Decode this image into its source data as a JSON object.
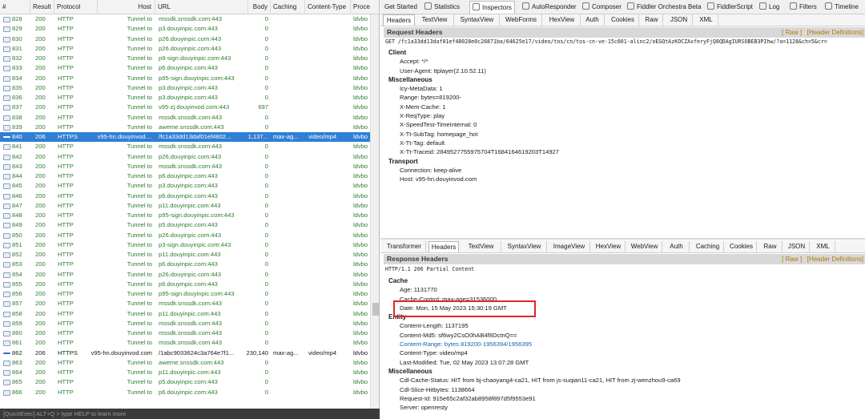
{
  "sessions": {
    "columns": {
      "num": "#",
      "result": "Result",
      "protocol": "Protocol",
      "host": "Host",
      "url": "URL",
      "body": "Body",
      "caching": "Caching",
      "ctype": "Content-Type",
      "process": "Proce"
    },
    "rows": [
      {
        "num": "828",
        "result": "200",
        "protocol": "HTTP",
        "host": "Tunnel to",
        "url": "mssdk.snssdk.com:443",
        "body": "0",
        "caching": "",
        "ctype": "",
        "process": "ldvbo",
        "kind": "normal"
      },
      {
        "num": "829",
        "result": "200",
        "protocol": "HTTP",
        "host": "Tunnel to",
        "url": "p3.douyinpic.com:443",
        "body": "0",
        "caching": "",
        "ctype": "",
        "process": "ldvbo",
        "kind": "normal"
      },
      {
        "num": "830",
        "result": "200",
        "protocol": "HTTP",
        "host": "Tunnel to",
        "url": "p26.douyinpic.com:443",
        "body": "0",
        "caching": "",
        "ctype": "",
        "process": "ldvbo",
        "kind": "normal"
      },
      {
        "num": "831",
        "result": "200",
        "protocol": "HTTP",
        "host": "Tunnel to",
        "url": "p26.douyinpic.com:443",
        "body": "0",
        "caching": "",
        "ctype": "",
        "process": "ldvbo",
        "kind": "normal"
      },
      {
        "num": "832",
        "result": "200",
        "protocol": "HTTP",
        "host": "Tunnel to",
        "url": "p9-sign.douyinpic.com:443",
        "body": "0",
        "caching": "",
        "ctype": "",
        "process": "ldvbo",
        "kind": "normal"
      },
      {
        "num": "833",
        "result": "200",
        "protocol": "HTTP",
        "host": "Tunnel to",
        "url": "p6.douyinpic.com:443",
        "body": "0",
        "caching": "",
        "ctype": "",
        "process": "ldvbo",
        "kind": "normal"
      },
      {
        "num": "834",
        "result": "200",
        "protocol": "HTTP",
        "host": "Tunnel to",
        "url": "p95-sign.douyinpic.com:443",
        "body": "0",
        "caching": "",
        "ctype": "",
        "process": "ldvbo",
        "kind": "normal"
      },
      {
        "num": "835",
        "result": "200",
        "protocol": "HTTP",
        "host": "Tunnel to",
        "url": "p3.douyinpic.com:443",
        "body": "0",
        "caching": "",
        "ctype": "",
        "process": "ldvbo",
        "kind": "normal"
      },
      {
        "num": "836",
        "result": "200",
        "protocol": "HTTP",
        "host": "Tunnel to",
        "url": "p3.douyinpic.com:443",
        "body": "0",
        "caching": "",
        "ctype": "",
        "process": "ldvbo",
        "kind": "normal"
      },
      {
        "num": "837",
        "result": "200",
        "protocol": "HTTP",
        "host": "Tunnel to",
        "url": "v95-zj.douyinvod.com:443",
        "body": "697",
        "caching": "",
        "ctype": "",
        "process": "ldvbo",
        "kind": "normal"
      },
      {
        "num": "838",
        "result": "200",
        "protocol": "HTTP",
        "host": "Tunnel to",
        "url": "mssdk.snssdk.com:443",
        "body": "0",
        "caching": "",
        "ctype": "",
        "process": "ldvbo",
        "kind": "normal"
      },
      {
        "num": "839",
        "result": "200",
        "protocol": "HTTP",
        "host": "Tunnel to",
        "url": "aweme.snssdk.com:443",
        "body": "0",
        "caching": "",
        "ctype": "",
        "process": "ldvbo",
        "kind": "normal"
      },
      {
        "num": "840",
        "result": "206",
        "protocol": "HTTPS",
        "host": "v95-hn.douyinvod....",
        "url": "/fc1a33dd13daf01ef4802...",
        "body": "1,137...",
        "caching": "max-ag...",
        "ctype": "video/mp4",
        "process": "ldvbo",
        "kind": "selected"
      },
      {
        "num": "841",
        "result": "200",
        "protocol": "HTTP",
        "host": "Tunnel to",
        "url": "mssdk.snssdk.com:443",
        "body": "0",
        "caching": "",
        "ctype": "",
        "process": "ldvbo",
        "kind": "normal"
      },
      {
        "num": "842",
        "result": "200",
        "protocol": "HTTP",
        "host": "Tunnel to",
        "url": "p26.douyinpic.com:443",
        "body": "0",
        "caching": "",
        "ctype": "",
        "process": "ldvbo",
        "kind": "normal"
      },
      {
        "num": "843",
        "result": "200",
        "protocol": "HTTP",
        "host": "Tunnel to",
        "url": "mssdk.snssdk.com:443",
        "body": "0",
        "caching": "",
        "ctype": "",
        "process": "ldvbo",
        "kind": "normal"
      },
      {
        "num": "844",
        "result": "200",
        "protocol": "HTTP",
        "host": "Tunnel to",
        "url": "p6.douyinpic.com:443",
        "body": "0",
        "caching": "",
        "ctype": "",
        "process": "ldvbo",
        "kind": "normal"
      },
      {
        "num": "845",
        "result": "200",
        "protocol": "HTTP",
        "host": "Tunnel to",
        "url": "p3.douyinpic.com:443",
        "body": "0",
        "caching": "",
        "ctype": "",
        "process": "ldvbo",
        "kind": "normal"
      },
      {
        "num": "846",
        "result": "200",
        "protocol": "HTTP",
        "host": "Tunnel to",
        "url": "p6.douyinpic.com:443",
        "body": "0",
        "caching": "",
        "ctype": "",
        "process": "ldvbo",
        "kind": "normal"
      },
      {
        "num": "847",
        "result": "200",
        "protocol": "HTTP",
        "host": "Tunnel to",
        "url": "p11.douyinpic.com:443",
        "body": "0",
        "caching": "",
        "ctype": "",
        "process": "ldvbo",
        "kind": "normal"
      },
      {
        "num": "848",
        "result": "200",
        "protocol": "HTTP",
        "host": "Tunnel to",
        "url": "p95-sign.douyinpic.com:443",
        "body": "0",
        "caching": "",
        "ctype": "",
        "process": "ldvbo",
        "kind": "normal"
      },
      {
        "num": "849",
        "result": "200",
        "protocol": "HTTP",
        "host": "Tunnel to",
        "url": "p5.douyinpic.com:443",
        "body": "0",
        "caching": "",
        "ctype": "",
        "process": "ldvbo",
        "kind": "normal"
      },
      {
        "num": "850",
        "result": "200",
        "protocol": "HTTP",
        "host": "Tunnel to",
        "url": "p26.douyinpic.com:443",
        "body": "0",
        "caching": "",
        "ctype": "",
        "process": "ldvbo",
        "kind": "normal"
      },
      {
        "num": "851",
        "result": "200",
        "protocol": "HTTP",
        "host": "Tunnel to",
        "url": "p3-sign.douyinpic.com:443",
        "body": "0",
        "caching": "",
        "ctype": "",
        "process": "ldvbo",
        "kind": "normal"
      },
      {
        "num": "852",
        "result": "200",
        "protocol": "HTTP",
        "host": "Tunnel to",
        "url": "p11.douyinpic.com:443",
        "body": "0",
        "caching": "",
        "ctype": "",
        "process": "ldvbo",
        "kind": "normal"
      },
      {
        "num": "853",
        "result": "200",
        "protocol": "HTTP",
        "host": "Tunnel to",
        "url": "p6.douyinpic.com:443",
        "body": "0",
        "caching": "",
        "ctype": "",
        "process": "ldvbo",
        "kind": "normal"
      },
      {
        "num": "854",
        "result": "200",
        "protocol": "HTTP",
        "host": "Tunnel to",
        "url": "p26.douyinpic.com:443",
        "body": "0",
        "caching": "",
        "ctype": "",
        "process": "ldvbo",
        "kind": "normal"
      },
      {
        "num": "855",
        "result": "200",
        "protocol": "HTTP",
        "host": "Tunnel to",
        "url": "p6.douyinpic.com:443",
        "body": "0",
        "caching": "",
        "ctype": "",
        "process": "ldvbo",
        "kind": "normal"
      },
      {
        "num": "856",
        "result": "200",
        "protocol": "HTTP",
        "host": "Tunnel to",
        "url": "p95-sign.douyinpic.com:443",
        "body": "0",
        "caching": "",
        "ctype": "",
        "process": "ldvbo",
        "kind": "normal"
      },
      {
        "num": "857",
        "result": "200",
        "protocol": "HTTP",
        "host": "Tunnel to",
        "url": "mssdk.snssdk.com:443",
        "body": "0",
        "caching": "",
        "ctype": "",
        "process": "ldvbo",
        "kind": "normal"
      },
      {
        "num": "858",
        "result": "200",
        "protocol": "HTTP",
        "host": "Tunnel to",
        "url": "p11.douyinpic.com:443",
        "body": "0",
        "caching": "",
        "ctype": "",
        "process": "ldvbo",
        "kind": "normal"
      },
      {
        "num": "859",
        "result": "200",
        "protocol": "HTTP",
        "host": "Tunnel to",
        "url": "mssdk.snssdk.com:443",
        "body": "0",
        "caching": "",
        "ctype": "",
        "process": "ldvbo",
        "kind": "normal"
      },
      {
        "num": "860",
        "result": "200",
        "protocol": "HTTP",
        "host": "Tunnel to",
        "url": "mssdk.snssdk.com:443",
        "body": "0",
        "caching": "",
        "ctype": "",
        "process": "ldvbo",
        "kind": "normal"
      },
      {
        "num": "861",
        "result": "200",
        "protocol": "HTTP",
        "host": "Tunnel to",
        "url": "mssdk.snssdk.com:443",
        "body": "0",
        "caching": "",
        "ctype": "",
        "process": "ldvbo",
        "kind": "normal"
      },
      {
        "num": "862",
        "result": "206",
        "protocol": "HTTPS",
        "host": "v95-hn.douyinvod.com",
        "url": "/1abc9033624c3a764e7f1...",
        "body": "230,140",
        "caching": "max-ag...",
        "ctype": "video/mp4",
        "process": "ldvbo",
        "kind": "highlight"
      },
      {
        "num": "863",
        "result": "200",
        "protocol": "HTTP",
        "host": "Tunnel to",
        "url": "aweme.snssdk.com:443",
        "body": "0",
        "caching": "",
        "ctype": "",
        "process": "ldvbo",
        "kind": "normal"
      },
      {
        "num": "864",
        "result": "200",
        "protocol": "HTTP",
        "host": "Tunnel to",
        "url": "p11.douyinpic.com:443",
        "body": "0",
        "caching": "",
        "ctype": "",
        "process": "ldvbo",
        "kind": "normal"
      },
      {
        "num": "865",
        "result": "200",
        "protocol": "HTTP",
        "host": "Tunnel to",
        "url": "p5.douyinpic.com:443",
        "body": "0",
        "caching": "",
        "ctype": "",
        "process": "ldvbo",
        "kind": "normal"
      },
      {
        "num": "866",
        "result": "200",
        "protocol": "HTTP",
        "host": "Tunnel to",
        "url": "p6.douyinpic.com:443",
        "body": "0",
        "caching": "",
        "ctype": "",
        "process": "ldvbo",
        "kind": "normal"
      }
    ]
  },
  "quickexec": {
    "text": "[QuickExec] ALT+Q > type HELP to learn more"
  },
  "top_tabs": [
    {
      "label": "Get Started",
      "icon": ""
    },
    {
      "label": "Statistics",
      "icon": "clock-icon"
    },
    {
      "label": "Inspectors",
      "icon": "magnifier-icon"
    },
    {
      "label": "AutoResponder",
      "icon": "bolt-icon"
    },
    {
      "label": "Composer",
      "icon": "pencil-icon"
    },
    {
      "label": "Fiddler Orchestra Beta",
      "icon": "fo-icon"
    },
    {
      "label": "FiddlerScript",
      "icon": "script-icon"
    },
    {
      "label": "Log",
      "icon": "log-icon"
    },
    {
      "label": "Filters",
      "icon": "checkbox-icon"
    },
    {
      "label": "Timeline",
      "icon": "timeline-icon"
    }
  ],
  "request_tabs": [
    "Headers",
    "TextView",
    "SyntaxView",
    "WebForms",
    "HexView",
    "Auth",
    "Cookies",
    "Raw",
    "JSON",
    "XML"
  ],
  "request": {
    "section_title": "Request Headers",
    "raw_link": "[ Raw ]",
    "defs_link": "[Header Definitions]",
    "request_line": "GET /fc1a33dd13daf01ef48028e0c26871ba/64625e17/video/tos/cn/tos-cn-ve-15c001-alinc2/oEGQtAzKOCZAxferyFjQ8QDAgIURSOBEB3PIhw/?a=1128&ch=5&cr=",
    "groups": [
      {
        "name": "Client",
        "items": [
          "Accept: */*",
          "User-Agent: ttplayer(2.10.52.11)"
        ]
      },
      {
        "name": "Miscellaneous",
        "items": [
          "Icy-MetaData: 1",
          "Range: bytes=819200-",
          "X-Mem-Cache: 1",
          "X-ReqType: play",
          "X-SpeedTest-TimeInternal: 0",
          "X-Tt-SubTag: homepage_hot",
          "X-Tt-Tag: default",
          "X-Tt-Traceid: 2849527755975704T1684164619203T14927"
        ]
      },
      {
        "name": "Transport",
        "items": [
          "Connection: keep-alive",
          "Host: v95-hn.douyinvod.com"
        ]
      }
    ]
  },
  "response_tabs": [
    "Transformer",
    "Headers",
    "TextView",
    "SyntaxView",
    "ImageView",
    "HexView",
    "WebView",
    "Auth",
    "Caching",
    "Cookies",
    "Raw",
    "JSON",
    "XML"
  ],
  "response": {
    "section_title": "Response Headers",
    "raw_link": "[ Raw ]",
    "defs_link": "[Header Definitions]",
    "status_line": "HTTP/1.1 206 Partial Content",
    "groups": [
      {
        "name": "Cache",
        "items": [
          "Age: 1131770",
          "Cache-Control: max-age=31536000",
          "Date: Mon, 15 May 2023 15:30:19 GMT"
        ]
      },
      {
        "name": "Entity",
        "items": [
          "Content-Length: 1137195",
          "Content-Md5: sf6wy2CsO0hAB4f8DctnQ==",
          "Content-Range: bytes 819200-1956394/1956395",
          "Content-Type: video/mp4",
          "Last-Modified: Tue, 02 May 2023 13:07:28 GMT"
        ]
      },
      {
        "name": "Miscellaneous",
        "items": [
          "Cdl-Cache-Status: HIT from bj-chaoyang4-ca21, HIT from js-suqian11-ca21, HIT from zj-wenzhou9-ca69",
          "Cdl-Slice-Hitbytes: 1138664",
          "Request-Id: 915e65c2af32ab8958f897d5f9553e91",
          "Server: openresty"
        ]
      }
    ]
  },
  "colors": {
    "accent": "#2f7fd6",
    "session_text": "#2e7d2e",
    "highlight_box": "#e32626"
  }
}
